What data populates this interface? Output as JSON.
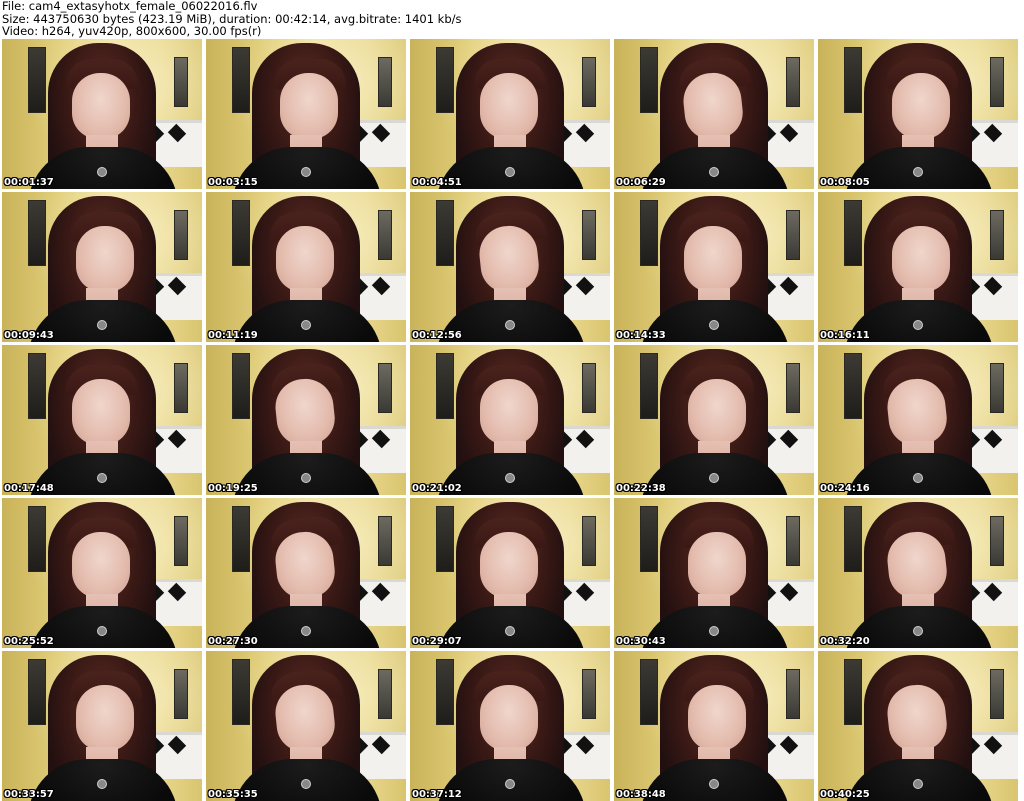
{
  "header": {
    "file_line": "File: cam4_extasyhotx_female_06022016.flv",
    "size_line": "Size: 443750630 bytes (423.19 MiB), duration: 00:42:14, avg.bitrate: 1401 kb/s",
    "video_line": "Video: h264, yuv420p, 800x600, 30.00 fps(r)"
  },
  "thumbnails": [
    {
      "timestamp": "00:01:37"
    },
    {
      "timestamp": "00:03:15"
    },
    {
      "timestamp": "00:04:51"
    },
    {
      "timestamp": "00:06:29"
    },
    {
      "timestamp": "00:08:05"
    },
    {
      "timestamp": "00:09:43"
    },
    {
      "timestamp": "00:11:19"
    },
    {
      "timestamp": "00:12:56"
    },
    {
      "timestamp": "00:14:33"
    },
    {
      "timestamp": "00:16:11"
    },
    {
      "timestamp": "00:17:48"
    },
    {
      "timestamp": "00:19:25"
    },
    {
      "timestamp": "00:21:02"
    },
    {
      "timestamp": "00:22:38"
    },
    {
      "timestamp": "00:24:16"
    },
    {
      "timestamp": "00:25:52"
    },
    {
      "timestamp": "00:27:30"
    },
    {
      "timestamp": "00:29:07"
    },
    {
      "timestamp": "00:30:43"
    },
    {
      "timestamp": "00:32:20"
    },
    {
      "timestamp": "00:33:57"
    },
    {
      "timestamp": "00:35:35"
    },
    {
      "timestamp": "00:37:12"
    },
    {
      "timestamp": "00:38:48"
    },
    {
      "timestamp": "00:40:25"
    }
  ]
}
